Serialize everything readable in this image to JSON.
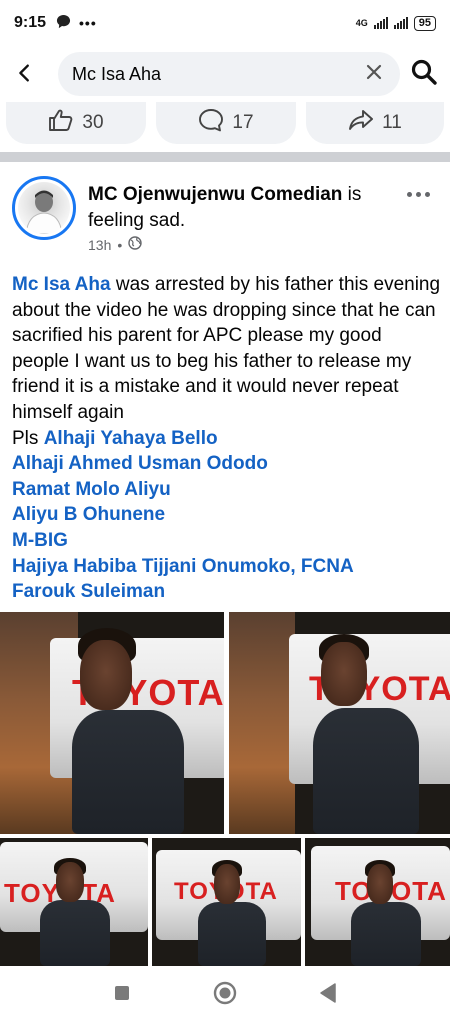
{
  "status": {
    "time": "9:15",
    "network": "4G",
    "battery": "95"
  },
  "search": {
    "query": "Mc Isa Aha"
  },
  "reactions": {
    "likes": "30",
    "comments": "17",
    "shares": "11"
  },
  "post": {
    "author": "MC Ojenwujenwu Comedian",
    "feeling": " is feeling sad.",
    "time": "13h",
    "audience_icon": "globe-icon",
    "mention_main": "Mc Isa Aha",
    "body_text": " was arrested by his father this evening about the video he was dropping since that he can sacrified his parent for APC please my good people I want us to beg his father to release my friend it is a mistake and it would never repeat himself again",
    "pls": "Pls ",
    "tags": [
      "Alhaji Yahaya Bello",
      "Alhaji Ahmed Usman Ododo",
      "Ramat Molo Aliyu",
      "Aliyu B Ohunene",
      "M-BIG",
      "Hajiya Habiba Tijjani Onumoko, FCNA",
      "Farouk Suleiman"
    ]
  },
  "photos": {
    "brand_text": "TOYOTA",
    "count": 5
  },
  "colors": {
    "accent": "#1877f2",
    "mention": "#1462c4",
    "pill_bg": "#f0f2f5"
  }
}
